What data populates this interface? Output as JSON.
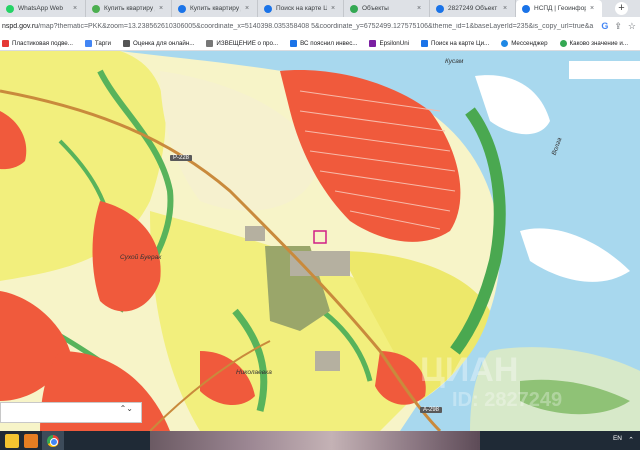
{
  "tabs": [
    {
      "label": "WhatsApp Web",
      "color": "#25d366"
    },
    {
      "label": "Купить квартиру д",
      "color": "#4caf50"
    },
    {
      "label": "Купить квартиру д",
      "color": "#1a73e8"
    },
    {
      "label": "Поиск на карте Ц",
      "color": "#1a73e8"
    },
    {
      "label": "Объекты",
      "color": "#34a853"
    },
    {
      "label": "2827249 Объект",
      "color": "#1a73e8"
    },
    {
      "label": "НСПД | Геоинфор",
      "color": "#1a73e8",
      "active": true
    }
  ],
  "new_tab_label": "+",
  "address": {
    "host": "nspd.gov.ru",
    "rest": "/map?thematic=PKK&zoom=13.238562610306005&coordinate_x=5140398.035358408 5&coordinate_y=6752499.127575106&theme_id=1&baseLayerId=235&is_copy_url=true&a"
  },
  "bookmarks": [
    {
      "label": "Пластиковая подве...",
      "color": "#e53935"
    },
    {
      "label": "Тарги",
      "color": "#4285f4"
    },
    {
      "label": "Оценка для онлайн...",
      "color": "#555555"
    },
    {
      "label": "ИЗВЕЩЕНИЕ о про...",
      "color": "#777777"
    },
    {
      "label": "ВС пояснил инвес...",
      "color": "#1a73e8"
    },
    {
      "label": "EpsilonUni",
      "color": "#7b1fa2"
    },
    {
      "label": "Поиск на карте Ци...",
      "color": "#1a73e8"
    },
    {
      "label": "Мессенджер",
      "color": "#1e88e5"
    },
    {
      "label": "Каково значение и...",
      "color": "#34a853"
    }
  ],
  "map_labels": {
    "river_kusam": "Кусам",
    "volga": "Волга",
    "settlement_buerak": "Сухой Буерак",
    "settlement_bottom": "Николаевка",
    "road_a298": "А-298",
    "road_top": "Р-228"
  },
  "watermark_primary": "ЦИАН",
  "watermark_secondary": "ID: 2827249",
  "select_chevron": "⌃⌄",
  "taskbar": {
    "lang": "EN",
    "tray": "⌃"
  },
  "colors": {
    "water": "#a8d8ee",
    "yellow_zone": "#f2ef7d",
    "light_zone": "#f7f4c8",
    "red_parcels": "#f05a3c",
    "green_zone": "#58b35b",
    "olive": "#9aa66a"
  }
}
